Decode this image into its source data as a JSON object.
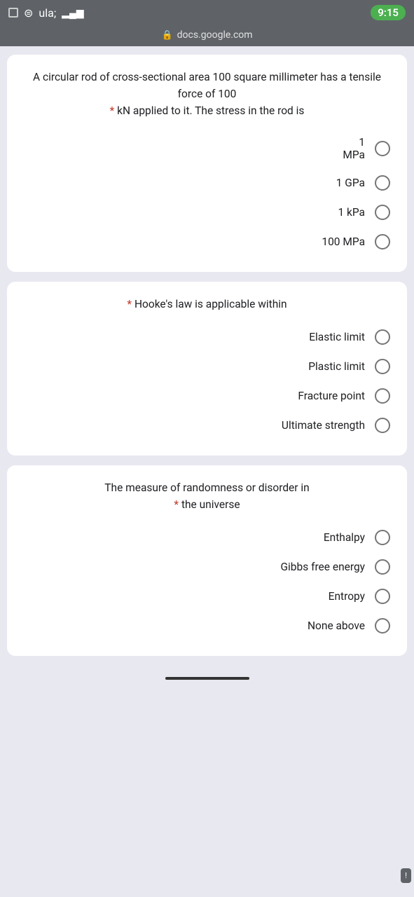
{
  "statusBar": {
    "time": "9:15",
    "url": "docs.google.com"
  },
  "questions": [
    {
      "id": "q1",
      "text": "A circular rod of cross-sectional area 100 square millimeter has a tensile force of 100",
      "required_text": "* kN applied to it. The stress in the rod is",
      "required": true,
      "options": [
        {
          "id": "q1o1",
          "label": "1\nMPa"
        },
        {
          "id": "q1o2",
          "label": "1 GPa"
        },
        {
          "id": "q1o3",
          "label": "1 kPa"
        },
        {
          "id": "q1o4",
          "label": "100 MPa"
        }
      ]
    },
    {
      "id": "q2",
      "required_prefix": "* ",
      "text": "Hooke's law is applicable within",
      "required": true,
      "options": [
        {
          "id": "q2o1",
          "label": "Elastic limit"
        },
        {
          "id": "q2o2",
          "label": "Plastic limit"
        },
        {
          "id": "q2o3",
          "label": "Fracture point"
        },
        {
          "id": "q2o4",
          "label": "Ultimate strength"
        }
      ]
    },
    {
      "id": "q3",
      "text": "The measure of randomness or disorder in",
      "required_text": "* the universe",
      "required": true,
      "options": [
        {
          "id": "q3o1",
          "label": "Enthalpy"
        },
        {
          "id": "q3o2",
          "label": "Gibbs free energy"
        },
        {
          "id": "q3o3",
          "label": "Entropy"
        },
        {
          "id": "q3o4",
          "label": "None above"
        }
      ]
    }
  ],
  "feedbackBtn": "!",
  "lockIcon": "🔒"
}
